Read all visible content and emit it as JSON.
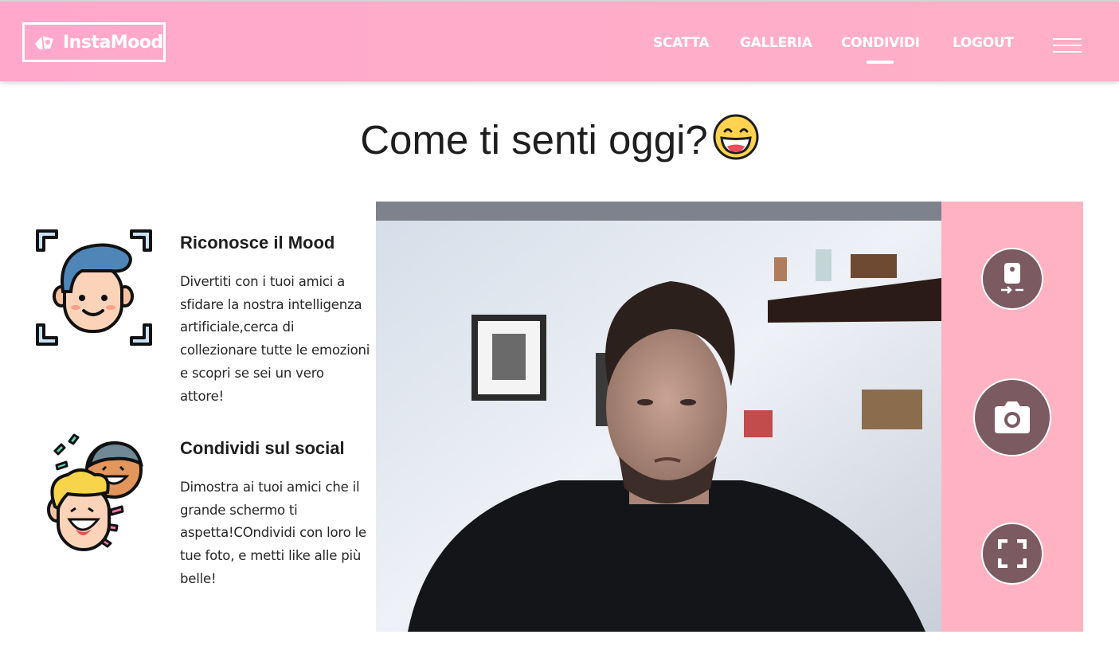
{
  "navbar": {
    "brand": "InstaMood",
    "links": [
      {
        "label": "SCATTA",
        "active": false
      },
      {
        "label": "GALLERIA",
        "active": false
      },
      {
        "label": "CONDIVIDI",
        "active": true
      },
      {
        "label": "LOGOUT",
        "active": false
      }
    ]
  },
  "main": {
    "title": "Come ti senti oggi?",
    "title_emoji": "grinning-face-emoji"
  },
  "features": [
    {
      "icon": "face-recognition-icon",
      "title": "Riconosce il Mood",
      "text": "Divertiti con i tuoi amici a sfidare la nostra intelligenza artificiale,cerca di collezionare tutte le emozioni e scopri se sei un vero attore!"
    },
    {
      "icon": "laughing-friends-icon",
      "title": "Condividi sul social",
      "text": "Dimostra ai tuoi amici che il grande schermo ti aspetta!COndividi con loro le tue foto, e metti like alle più belle!"
    }
  ],
  "camera": {
    "controls": [
      {
        "icon": "switch-camera-icon"
      },
      {
        "icon": "camera-icon"
      },
      {
        "icon": "fullscreen-icon"
      }
    ]
  },
  "colors": {
    "navbar": "#ffa8cb",
    "controls_panel": "#ffb2c2",
    "control_button": "#7b5a62",
    "text": "#1e1e1e"
  }
}
